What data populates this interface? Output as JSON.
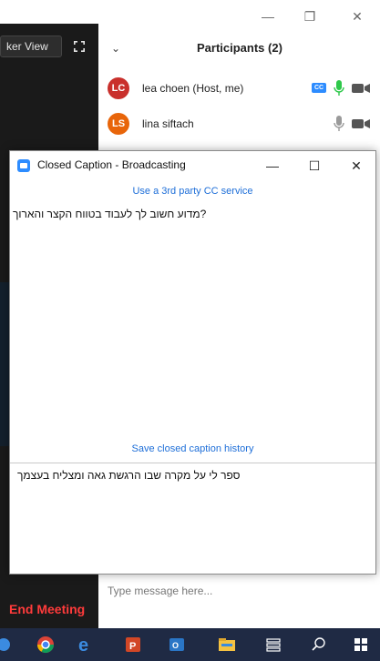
{
  "meeting": {
    "view_button_label": "ker View",
    "end_meeting_label": "End Meeting"
  },
  "window_controls": {
    "minimize": "—",
    "restore": "❐",
    "close": "✕"
  },
  "participants": {
    "title": "Participants (2)",
    "items": [
      {
        "initials": "LC",
        "name": "lea choen (Host, me)",
        "avatar_color": "#c9302c",
        "cc_badge": "CC"
      },
      {
        "initials": "LS",
        "name": "lina siftach",
        "avatar_color": "#e8650a"
      }
    ]
  },
  "chat": {
    "placeholder": "Type message here..."
  },
  "cc_dialog": {
    "title": "Closed Caption - Broadcasting",
    "minimize": "—",
    "maximize": "☐",
    "close": "✕",
    "third_party_link": "Use a 3rd party CC service",
    "caption_text": "?מדוע חשוב לך לעבוד בטווח הקצר והארוך",
    "save_history_link": "Save closed caption history",
    "input_text": "ספר לי על מקרה שבו הרגשת גאה ומצליח בעצמך"
  },
  "colors": {
    "accent_blue": "#2d8cff",
    "link_blue": "#1d6ed8",
    "end_meeting_red": "#ff3b3b",
    "mic_green": "#2ec84a"
  },
  "taskbar": {
    "icons": [
      "browser-icon",
      "chrome-icon",
      "edge-icon",
      "powerpoint-icon",
      "outlook-icon",
      "file-explorer-icon",
      "task-view-icon",
      "search-icon",
      "windows-icon"
    ]
  }
}
